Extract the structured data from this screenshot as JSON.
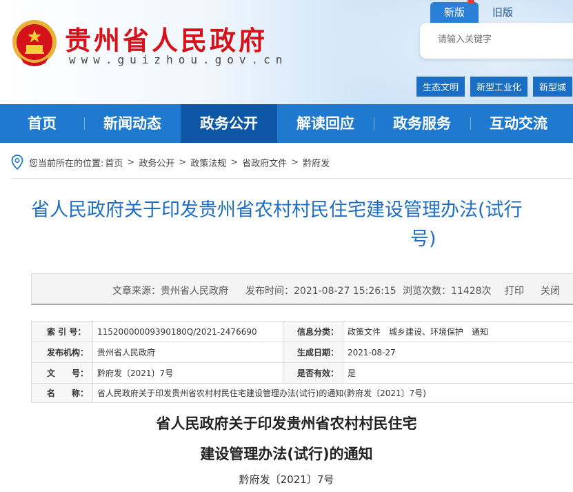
{
  "header": {
    "site_title": "贵州省人民政府",
    "site_url": "www.guizhou.gov.cn",
    "version_tabs": [
      "新版",
      "旧版"
    ],
    "search_placeholder": "请输入关键字",
    "quick_links": [
      "生态文明",
      "新型工业化",
      "新型城"
    ]
  },
  "nav": {
    "items": [
      "首页",
      "新闻动态",
      "政务公开",
      "解读回应",
      "政务服务",
      "互动交流"
    ],
    "active": "政务公开"
  },
  "breadcrumb": {
    "prefix": "您当前所在的位置:",
    "items": [
      "首页",
      "政务公开",
      "政策法规",
      "省政府文件",
      "黔府发"
    ]
  },
  "article": {
    "title_line1": "省人民政府关于印发贵州省农村村民住宅建设管理办法(试行",
    "title_line2": "号)",
    "source": "文章来源：贵州省人民政府",
    "publish_time": "发布时间：2021-08-27 15:26:15",
    "views": "浏览次数：11428次",
    "print_label": "打印",
    "close_label": "关闭"
  },
  "meta": {
    "index_label": "索 引 号：",
    "index_value": "11520000009390180Q/2021-2476690",
    "category_label": "信息分类：",
    "category_value": "政策文件　城乡建设、环境保护　通知",
    "org_label": "发布机构：",
    "org_value": "贵州省人民政府",
    "date_label": "生成日期：",
    "date_value": "2021-08-27",
    "doc_label": "文　　号：",
    "doc_value": "黔府发〔2021〕7号",
    "valid_label": "是否有效：",
    "valid_value": "是",
    "name_label": "名　　称：",
    "name_value": "省人民政府关于印发贵州省农村村民住宅建设管理办法(试行)的通知(黔府发〔2021〕7号)"
  },
  "body": {
    "heading_line1": "省人民政府关于印发贵州省农村村民住宅",
    "heading_line2": "建设管理办法(试行)的通知",
    "doc_number": "黔府发〔2021〕7号"
  },
  "colors": {
    "nav_bg": "#1f79cf",
    "nav_active": "#0d57a6",
    "title_red": "#d4121a",
    "title_blue": "#1f6ec4"
  }
}
